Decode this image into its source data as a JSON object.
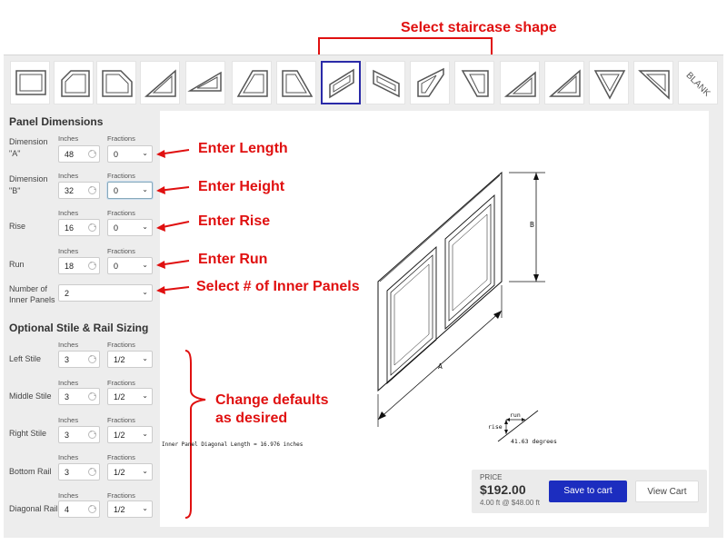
{
  "annotations": {
    "select_shape": "Select staircase shape",
    "enter_length": "Enter Length",
    "enter_height": "Enter Height",
    "enter_rise": "Enter Rise",
    "enter_run": "Enter Run",
    "select_panels": "Select # of Inner Panels",
    "change_defaults_1": "Change defaults",
    "change_defaults_2": "as desired"
  },
  "shapes": {
    "blank_label": "BLANK",
    "selected_index": 7
  },
  "panel_dimensions": {
    "title": "Panel Dimensions",
    "inches_header": "Inches",
    "fractions_header": "Fractions",
    "rows": [
      {
        "label_line1": "Dimension",
        "label_line2": "\"A\"",
        "inches": "48",
        "fraction": "0"
      },
      {
        "label_line1": "Dimension",
        "label_line2": "\"B\"",
        "inches": "32",
        "fraction": "0"
      },
      {
        "label_line1": "Rise",
        "label_line2": "",
        "inches": "16",
        "fraction": "0"
      },
      {
        "label_line1": "Run",
        "label_line2": "",
        "inches": "18",
        "fraction": "0"
      }
    ],
    "inner_panels_label_1": "Number of",
    "inner_panels_label_2": "Inner Panels",
    "inner_panels_value": "2"
  },
  "stile_rail": {
    "title": "Optional Stile & Rail Sizing",
    "inches_header": "Inches",
    "fractions_header": "Fractions",
    "rows": [
      {
        "label": "Left Stile",
        "inches": "3",
        "fraction": "1/2"
      },
      {
        "label": "Middle Stile",
        "inches": "3",
        "fraction": "1/2"
      },
      {
        "label": "Right Stile",
        "inches": "3",
        "fraction": "1/2"
      },
      {
        "label": "Bottom Rail",
        "inches": "3",
        "fraction": "1/2"
      },
      {
        "label": "Diagonal Rail",
        "inches": "4",
        "fraction": "1/2"
      }
    ]
  },
  "drawing": {
    "label_a": "A",
    "label_b": "B",
    "run_label": "run",
    "rise_label": "rise",
    "angle_label": "41.63 degrees",
    "diagonal_text": "Inner Panel Diagonal Length = 16.976 inches"
  },
  "price": {
    "label": "PRICE",
    "amount": "$192.00",
    "detail": "4.00 ft @ $48.00 ft",
    "save_label": "Save to cart",
    "view_label": "View Cart"
  },
  "colors": {
    "annotation": "#e01010",
    "primary_button": "#1c2dbf",
    "selected_tile_border": "#2a2aa8"
  }
}
